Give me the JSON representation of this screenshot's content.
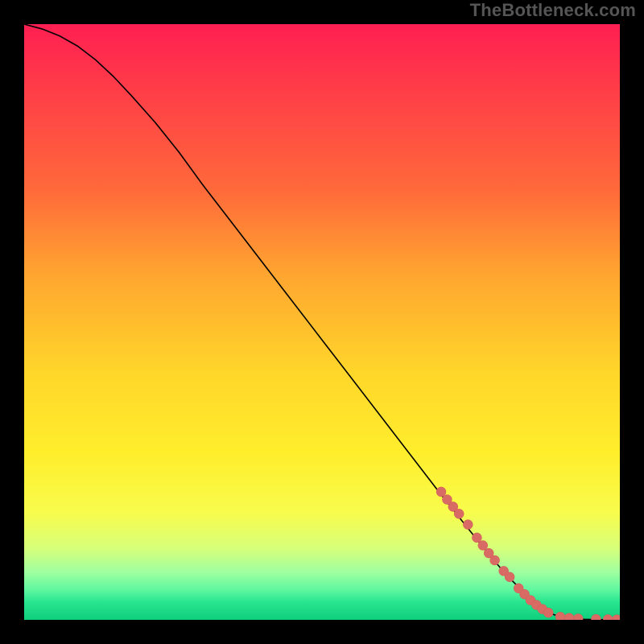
{
  "watermark": "TheBottleneck.com",
  "chart_data": {
    "type": "line",
    "title": "",
    "xlabel": "",
    "ylabel": "",
    "xlim": [
      0,
      100
    ],
    "ylim": [
      0,
      100
    ],
    "series": [
      {
        "name": "curve",
        "x": [
          0,
          3,
          6,
          9,
          12,
          15,
          18,
          22,
          26,
          30,
          35,
          40,
          45,
          50,
          55,
          60,
          65,
          70,
          74,
          78,
          81,
          84,
          86,
          88,
          90,
          92,
          94,
          96,
          98,
          100
        ],
        "y": [
          100,
          99.2,
          98.0,
          96.3,
          94.0,
          91.2,
          88.0,
          83.5,
          78.5,
          73.0,
          66.5,
          60.0,
          53.5,
          47.0,
          40.5,
          34.0,
          27.5,
          21.0,
          16.0,
          11.0,
          7.5,
          4.5,
          2.5,
          1.2,
          0.5,
          0.2,
          0.1,
          0.05,
          0.02,
          0.0
        ]
      }
    ],
    "markers": {
      "name": "highlighted-points",
      "color": "#d86b63",
      "x": [
        70,
        71,
        72,
        73,
        74.5,
        76,
        77,
        78,
        79,
        80.5,
        81.5,
        83,
        84,
        85,
        86,
        87,
        88,
        90,
        91.5,
        93,
        96,
        98,
        99.5
      ],
      "y": [
        21.5,
        20.2,
        19.0,
        17.8,
        16.0,
        13.8,
        12.5,
        11.2,
        10.0,
        8.2,
        7.2,
        5.3,
        4.3,
        3.3,
        2.5,
        1.8,
        1.2,
        0.5,
        0.3,
        0.2,
        0.12,
        0.08,
        0.05
      ]
    },
    "gradient_note": "Background encodes value: red (top) = worst, green (bottom) = best"
  }
}
